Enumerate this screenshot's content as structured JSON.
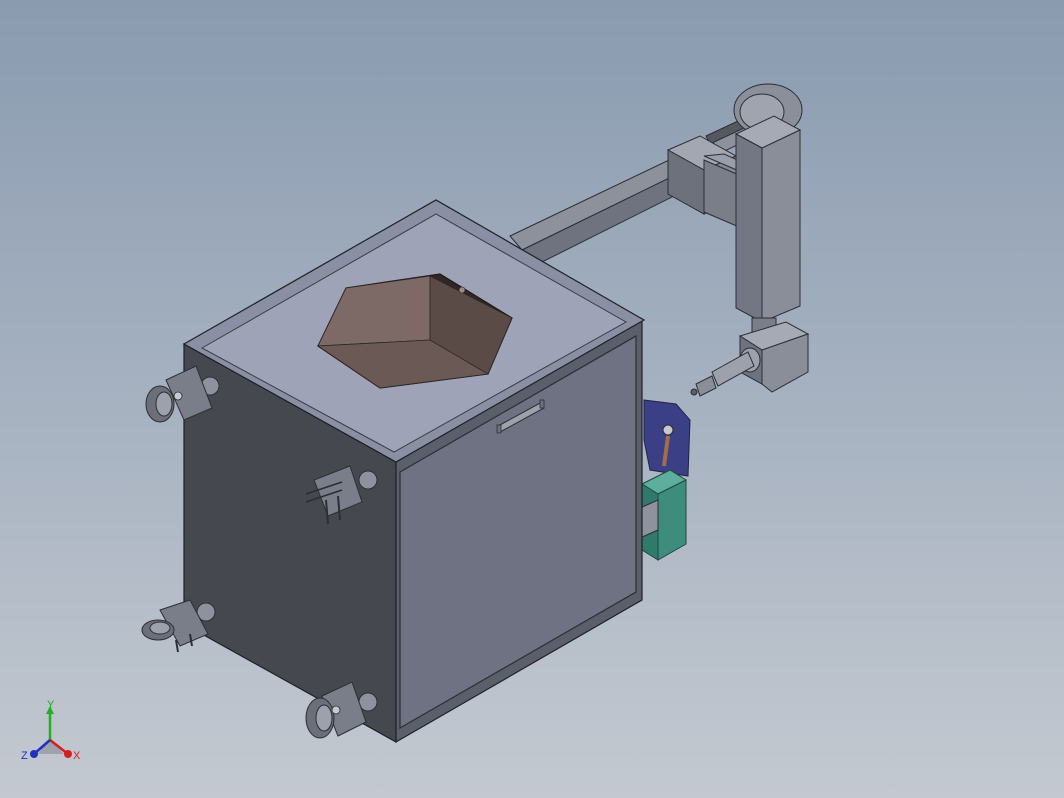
{
  "viewport": {
    "background_top": "#8a9bb0",
    "background_bottom": "#c4c9d0"
  },
  "model": {
    "parts": [
      "cabinet-body",
      "cabinet-top-panel",
      "hexagonal-hopper",
      "front-door-panel",
      "door-handle",
      "caster-wheel-front-left",
      "caster-wheel-middle-left",
      "caster-wheel-rear-left",
      "caster-wheel-front-bottom",
      "gantry-arm-horizontal",
      "gantry-column-vertical",
      "nozzle-head",
      "mounting-bracket",
      "green-motor-block",
      "blue-plate"
    ],
    "colors": {
      "body_dark": "#45484f",
      "body_front": "#6e7282",
      "top_panel": "#9ea3b7",
      "hopper_dark": "#5a4b47",
      "hopper_light": "#7d6a66",
      "arm": "#7e828e",
      "motor": "#3d8c7c",
      "blue_plate": "#3b3f86"
    }
  },
  "triad": {
    "x_label": "X",
    "y_label": "Y",
    "z_label": "Z",
    "x_color": "#d02020",
    "y_color": "#20b020",
    "z_color": "#2030c0"
  }
}
